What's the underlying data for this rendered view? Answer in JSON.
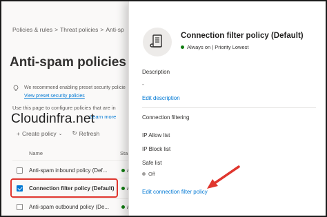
{
  "background": {
    "breadcrumb": [
      "Policies & rules",
      "Threat policies",
      "Anti-sp"
    ],
    "breadcrumb_sep": ">",
    "page_title": "Anti-spam policies",
    "recommendation": "We recommend enabling preset security policie",
    "recommendation_link": "View preset security policies",
    "use_text": "Use this page to configure policies that are in",
    "watermark": "Cloudinfra.net",
    "learn_more": "Learn more",
    "toolbar": {
      "create": "Create policy",
      "refresh": "Refresh"
    },
    "columns": {
      "name": "Name",
      "status": "Sta"
    },
    "rows": [
      {
        "name": "Anti-spam inbound policy (Def...",
        "status": "A",
        "checked": false
      },
      {
        "name": "Connection filter policy (Default)",
        "status": "A",
        "checked": true
      },
      {
        "name": "Anti-spam outbound policy (De...",
        "status": "A",
        "checked": false
      }
    ]
  },
  "panel": {
    "title": "Connection filter policy (Default)",
    "subtitle": "Always on | Priority Lowest",
    "description_label": "Description",
    "description_value": "-",
    "edit_description": "Edit description",
    "connection_filtering": "Connection filtering",
    "ip_allow": "IP Allow list",
    "ip_block": "IP Block list",
    "safe_list": "Safe list",
    "safe_list_value": "Off",
    "edit_policy": "Edit connection filter policy"
  },
  "colors": {
    "accent": "#0078d4",
    "status_on": "#107c10",
    "highlight": "#e0362e"
  }
}
